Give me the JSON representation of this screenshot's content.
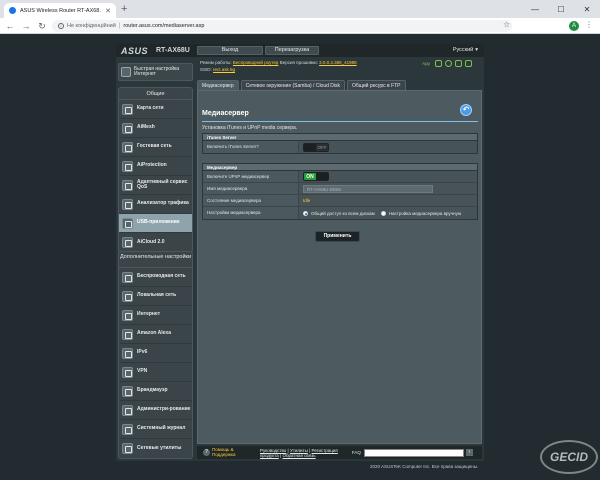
{
  "browser": {
    "tab_title": "ASUS Wireless Router RT-AX68...",
    "new_tab": "+",
    "security_label": "Не конфіденційний",
    "url": "router.asus.com/mediaserver.asp",
    "profile_initial": "A",
    "window_controls": [
      "—",
      "☐",
      "✕"
    ]
  },
  "router": {
    "logo": "ASUS",
    "model": "RT-AX68U",
    "buttons": {
      "logout": "Выход",
      "reboot": "Перезагрузка"
    },
    "language": "Русский",
    "status": {
      "mode_label": "Режим работы:",
      "mode_value": "Беспроводной роутер",
      "firmware_label": "Версия прошивки:",
      "firmware_value": "3.0.0.4.386_41988",
      "ssid_label": "SSID:",
      "ssid_value": "rect.ask.5g",
      "app_label": "App"
    }
  },
  "sidebar": {
    "qis": "Быстрая настройка Интернет",
    "general_title": "Общие",
    "general_items": [
      "Карта сети",
      "AiMesh",
      "Гостевая сеть",
      "AiProtection",
      "Адаптивный сервис QoS",
      "Анализатор трафика",
      "USB-приложение",
      "AiCloud 2.0"
    ],
    "advanced_title": "Дополнительные настройки",
    "advanced_items": [
      "Беспроводная сеть",
      "Локальная сеть",
      "Интернет",
      "Amazon Alexa",
      "IPv6",
      "VPN",
      "Брандмауэр",
      "Администри-рование",
      "Системный журнал",
      "Сетевые утилиты"
    ]
  },
  "tabs": [
    "Медиасервер",
    "Сетевое окружение (Samba) / Cloud Disk",
    "Общий ресурс в FTP"
  ],
  "content": {
    "title": "Медиасервер",
    "description": "Установка iTunes и UPnP media сервера.",
    "itunes": {
      "header": "iTunes Server",
      "enable_label": "Включить iTunes Server?",
      "enable_value": "OFF"
    },
    "media": {
      "header": "Медиасервер",
      "upnp_label": "Включите UPnP медиасервер",
      "upnp_value": "ON",
      "name_label": "Имя медиасервера",
      "name_value": "RT-AX68U-BB68",
      "state_label": "Состояние медиасервера",
      "state_value": "Idle",
      "settings_label": "Настройки медиасервера",
      "option_all": "Общий доступ ко всем дискам",
      "option_manual": "Настройка медиасервера вручную"
    },
    "apply": "Применить"
  },
  "footer": {
    "help": "Помощь & Поддержка",
    "links_line1": [
      "Руководство",
      "Утилиты",
      "Регистрация"
    ],
    "links_line2": [
      "продукта",
      "Обратная связь"
    ],
    "faq": "FAQ",
    "go": "›"
  },
  "copyright": "2020 ASUSTeK Computer Inc. Все права защищены."
}
